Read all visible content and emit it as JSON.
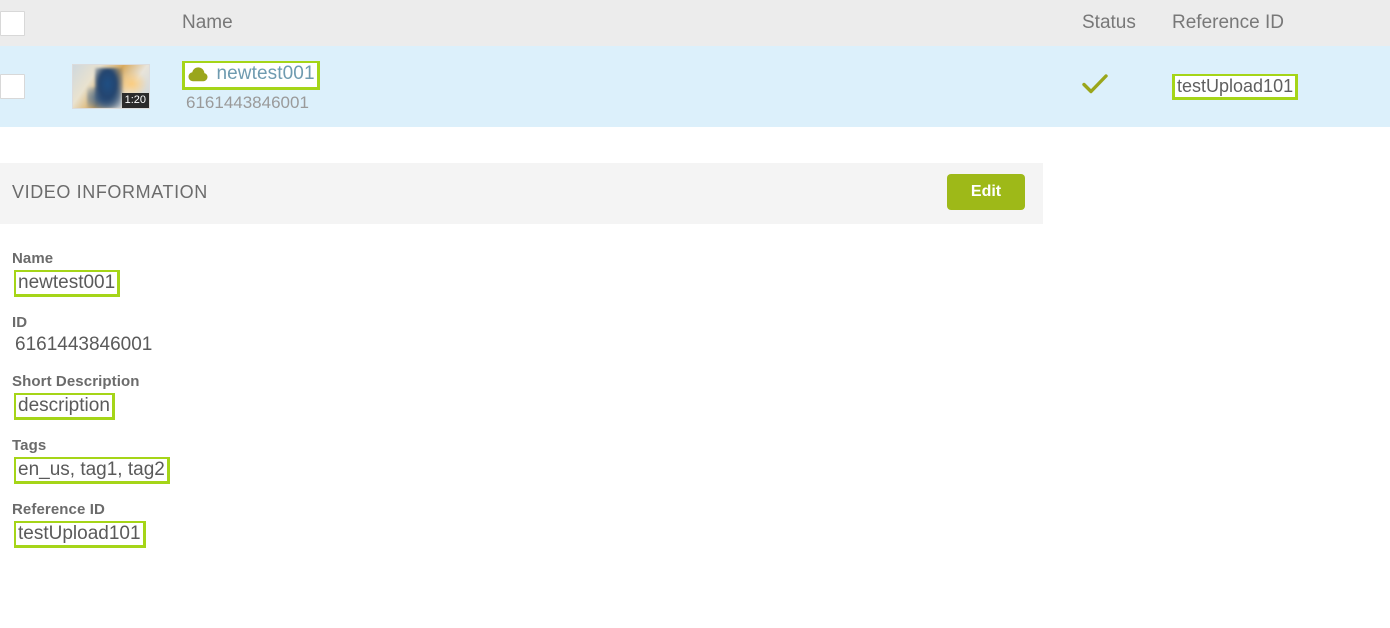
{
  "table": {
    "columns": {
      "checkbox": "",
      "name": "Name",
      "status": "Status",
      "reference_id": "Reference ID"
    },
    "rows": [
      {
        "thumbnail_duration": "1:20",
        "name": "newtest001",
        "video_id": "6161443846001",
        "status_icon": "check-icon",
        "reference_id": "testUpload101",
        "selected": false
      }
    ]
  },
  "info_panel": {
    "title": "VIDEO INFORMATION",
    "edit_label": "Edit"
  },
  "details": {
    "name_label": "Name",
    "name_value": "newtest001",
    "id_label": "ID",
    "id_value": "6161443846001",
    "short_description_label": "Short Description",
    "short_description_value": "description",
    "tags_label": "Tags",
    "tags_value": "en_us, tag1, tag2",
    "reference_id_label": "Reference ID",
    "reference_id_value": "testUpload101"
  },
  "colors": {
    "highlight": "#a5d518",
    "accent_green": "#9eb918",
    "row_selected": "#dcf0fb",
    "header_gray": "#ececec",
    "panel_gray": "#f4f4f4",
    "link": "#6f9bb0"
  }
}
